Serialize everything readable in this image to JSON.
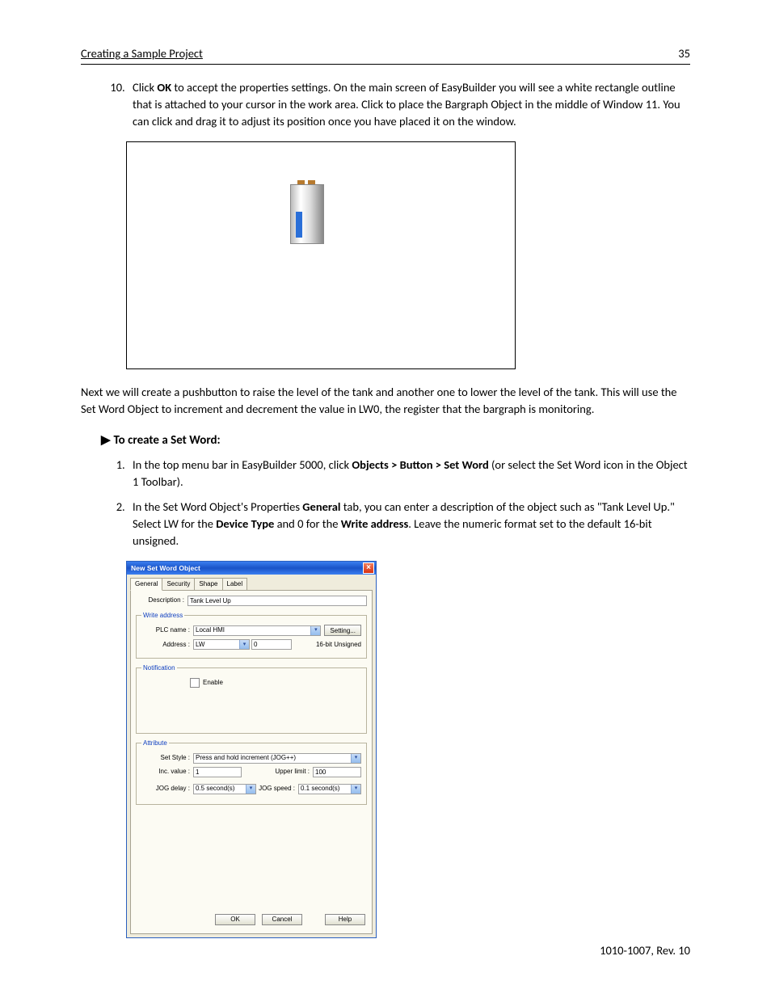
{
  "header": {
    "title": "Creating a Sample Project",
    "page": "35"
  },
  "step10": {
    "num": "10.",
    "pre": "Click ",
    "bold": "OK",
    "post": " to accept the properties settings. On the main screen of EasyBuilder you will see a white rectangle outline that is attached to your cursor in the work area. Click to place the Bargraph Object in the middle of Window 11. You can click and drag it to adjust its position once you have placed it on the window."
  },
  "nextpara": "Next we will create a pushbutton to raise the level of the tank and another one to lower the level of the tank. This will use the Set Word Object to increment and decrement the value in LW0, the register that the bargraph is monitoring.",
  "section2": {
    "tri": "▶",
    "title": "To create a Set Word:"
  },
  "s2steps": {
    "s1": {
      "pre": "In the top menu bar in EasyBuilder 5000, click ",
      "bold": "Objects > Button > Set Word",
      "post": " (or select the Set Word icon in the Object 1 Toolbar)."
    },
    "s2": {
      "a": "In the Set Word Object's Properties ",
      "b": "General",
      "c": " tab, you can enter a description of the object such as \"Tank Level Up.\" Select LW for the ",
      "d": "Device Type",
      "e": " and 0 for the ",
      "f": "Write address",
      "g": ". Leave the numeric format set to the default 16-bit unsigned."
    }
  },
  "dialog": {
    "title": "New  Set Word Object",
    "tabs": [
      "General",
      "Security",
      "Shape",
      "Label"
    ],
    "desc_label": "Description :",
    "desc_value": "Tank Level Up",
    "grp_write": "Write address",
    "plc_label": "PLC name :",
    "plc_value": "Local HMI",
    "setting_btn": "Setting...",
    "addr_label": "Address :",
    "addr_type": "LW",
    "addr_val": "0",
    "numfmt": "16-bit Unsigned",
    "grp_notif": "Notification",
    "enable_label": "Enable",
    "grp_attr": "Attribute",
    "setstyle_label": "Set Style :",
    "setstyle_value": "Press and hold increment (JOG++)",
    "incval_label": "Inc. value :",
    "incval_value": "1",
    "upper_label": "Upper limit :",
    "upper_value": "100",
    "jogdelay_label": "JOG delay :",
    "jogdelay_value": "0.5  second(s)",
    "jogspeed_label": "JOG speed :",
    "jogspeed_value": "0.1  second(s)",
    "btn_ok": "OK",
    "btn_cancel": "Cancel",
    "btn_help": "Help"
  },
  "footer": "1010-1007, Rev. 10"
}
